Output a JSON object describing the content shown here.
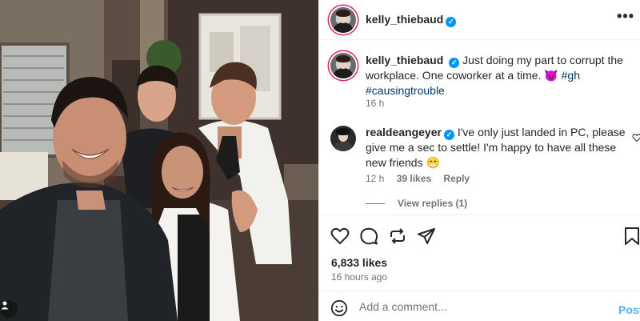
{
  "post": {
    "author": "kelly_thiebaud",
    "caption_text": "Just doing my part to corrupt the workplace. One coworker at a time.",
    "caption_emoji": "😈",
    "hashtags": [
      "#gh",
      "#causingtrouble"
    ],
    "caption_time": "16 h",
    "likes": "6,833 likes",
    "posted_ago": "16 hours ago"
  },
  "header": {
    "username": "kelly_thiebaud",
    "more_label": "•••"
  },
  "comment": {
    "username": "realdeangeyer",
    "text": "I've only just landed in PC, please give me a sec to settle! I'm happy to have all these new friends",
    "emoji": "😁",
    "time": "12 h",
    "likes": "39 likes",
    "reply_label": "Reply",
    "view_replies": "View replies (1)"
  },
  "add_comment": {
    "placeholder": "Add a comment...",
    "post_label": "Post"
  },
  "icons": {
    "verified": "verified-badge-icon",
    "like": "heart-icon",
    "comment": "comment-icon",
    "share": "share-icon",
    "send": "send-icon",
    "save": "bookmark-icon",
    "emoji": "emoji-icon",
    "user_tag": "user-tag-icon"
  },
  "colors": {
    "link": "#00376b",
    "verified": "#0095f6",
    "post_button": "#4cb5f9",
    "meta": "#737373"
  }
}
